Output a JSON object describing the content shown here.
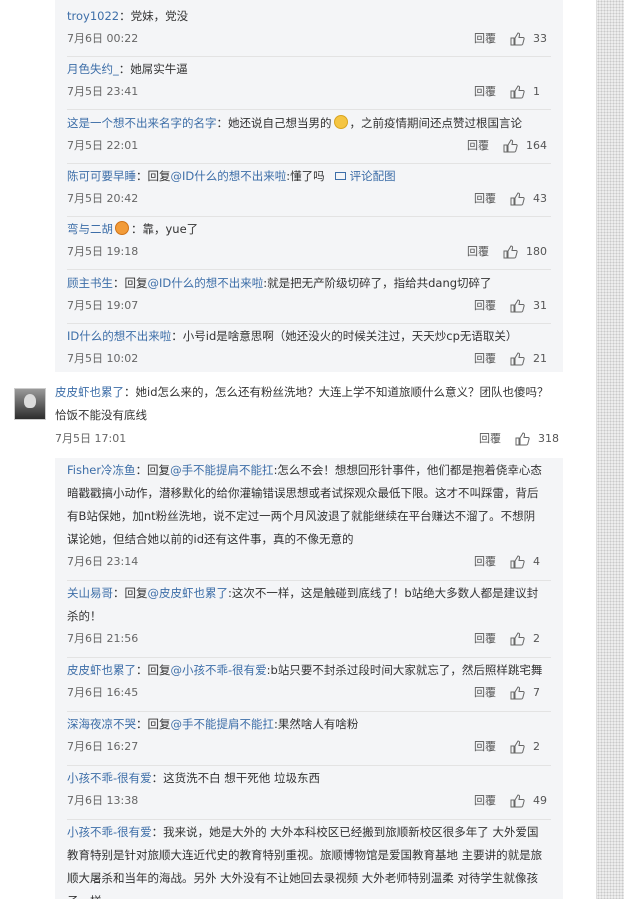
{
  "labels": {
    "reply": "回覆",
    "image_link": "评论配图"
  },
  "thread1": [
    {
      "user": "troy1022",
      "segments": [
        {
          "t": "：党妹，党没"
        }
      ],
      "time": "7月6日 00:22",
      "likes": "33"
    },
    {
      "user": "月色失约_",
      "segments": [
        {
          "t": "：她屌实牛逼"
        }
      ],
      "time": "7月5日 23:41",
      "likes": "1"
    },
    {
      "user": "这是一个想不出来名字的名字",
      "segments": [
        {
          "t": "：她还说自己想当男的"
        },
        {
          "emoji": "shy-emoji"
        },
        {
          "t": "，之前疫情期间还点赞过根国言论"
        }
      ],
      "time": "7月5日 22:01",
      "likes": "164"
    },
    {
      "user": "陈可可要早睡",
      "segments": [
        {
          "t": "：回复"
        },
        {
          "at": "@ID什么的想不出来啦"
        },
        {
          "t": ":懂了吗"
        }
      ],
      "image_link": true,
      "time": "7月5日 20:42",
      "likes": "43"
    },
    {
      "user": "弯与二胡",
      "segments": [
        {
          "emoji": "badge-emoji"
        },
        {
          "t": "：靠，yue了"
        }
      ],
      "time": "7月5日 19:18",
      "likes": "180"
    },
    {
      "user": "顾主书生",
      "segments": [
        {
          "t": "：回复"
        },
        {
          "at": "@ID什么的想不出来啦"
        },
        {
          "t": ":就是把无产阶级切碎了，指给共dang切碎了"
        }
      ],
      "time": "7月5日 19:07",
      "likes": "31"
    },
    {
      "user": "ID什么的想不出来啦",
      "segments": [
        {
          "t": "：小号id是啥意思啊（她还没火的时候关注过，天天炒cp无语取关）"
        }
      ],
      "time": "7月5日 10:02",
      "likes": "21"
    }
  ],
  "main_comment": {
    "user": "皮皮虾也累了",
    "text_lines": [
      "：她id怎么来的，怎么还有粉丝洗地？大连上学不知道旅顺什么意义？团队也傻吗？",
      "恰饭不能没有底线"
    ],
    "time": "7月5日 17:01",
    "likes": "318"
  },
  "thread2": [
    {
      "user": "Fisher冷冻鱼",
      "lines": [
        [
          {
            "t": "：回复"
          },
          {
            "at": "@手不能提肩不能扛"
          },
          {
            "t": ":怎么不会！想想回形针事件，他们都是抱着侥幸心态"
          }
        ],
        [
          {
            "t": "暗戳戳搞小动作，潜移默化的给你灌输错误思想或者试探观众最低下限。这才不叫踩雷，背后"
          }
        ],
        [
          {
            "t": "有B站保她，加nt粉丝洗地，说不定过一两个月风波退了就能继续在平台赚达不溜了。不想阴"
          }
        ],
        [
          {
            "t": "谋论她，但结合她以前的id还有这件事，真的不像无意的"
          }
        ]
      ],
      "time": "7月6日 23:14",
      "likes": "4"
    },
    {
      "user": "关山易哥",
      "lines": [
        [
          {
            "t": "：回复"
          },
          {
            "at": "@皮皮虾也累了"
          },
          {
            "t": ":这次不一样，这是触碰到底线了！b站绝大多数人都是建议封"
          }
        ],
        [
          {
            "t": "杀的！"
          }
        ]
      ],
      "time": "7月6日 21:56",
      "likes": "2"
    },
    {
      "user": "皮皮虾也累了",
      "lines": [
        [
          {
            "t": "：回复"
          },
          {
            "at": "@小孩不乖-很有爱"
          },
          {
            "t": ":b站只要不封杀过段时间大家就忘了，然后照样跳宅舞"
          }
        ]
      ],
      "time": "7月6日 16:45",
      "likes": "7"
    },
    {
      "user": "深海夜凉不哭",
      "lines": [
        [
          {
            "t": "：回复"
          },
          {
            "at": "@手不能提肩不能扛"
          },
          {
            "t": ":果然啥人有啥粉"
          }
        ]
      ],
      "time": "7月6日 16:27",
      "likes": "2"
    },
    {
      "user": "小孩不乖-很有爱",
      "lines": [
        [
          {
            "t": "：这货洗不白 想干死他 垃圾东西"
          }
        ]
      ],
      "time": "7月6日 13:38",
      "likes": "49"
    },
    {
      "user": "小孩不乖-很有爱",
      "lines": [
        [
          {
            "t": "：我来说，她是大外的 大外本科校区已经搬到旅顺新校区很多年了 大外爱国"
          }
        ],
        [
          {
            "t": "教育特别是针对旅顺大连近代史的教育特别重视。旅顺博物馆是爱国教育基地 主要讲的就是旅"
          }
        ],
        [
          {
            "t": "顺大屠杀和当年的海战。另外 大外没有不让她回去录视频 大外老师特别温柔 对待学生就像孩"
          }
        ],
        [
          {
            "t": "子一样"
          }
        ]
      ],
      "time": "",
      "likes": ""
    }
  ]
}
